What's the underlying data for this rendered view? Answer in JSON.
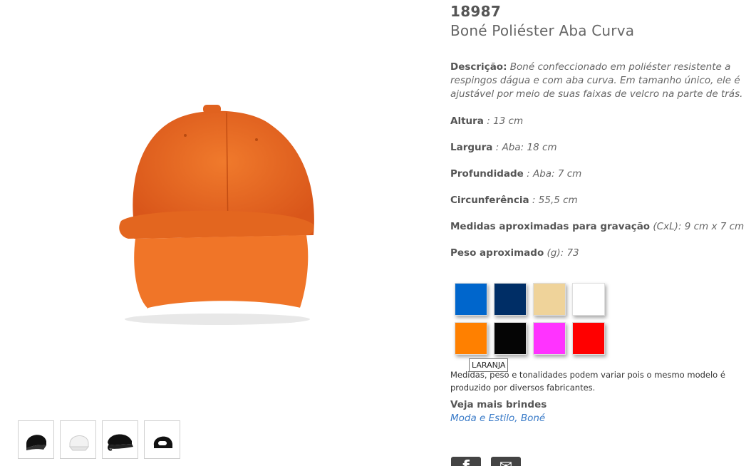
{
  "product": {
    "code": "18987",
    "title": "Boné Poliéster Aba Curva",
    "description_label": "Descrição:",
    "description_text": "Boné confeccionado em poliéster resistente a respingos dágua e com aba curva. Em tamanho único, ele é ajustável por meio de suas faixas de velcro na parte de trás."
  },
  "specs": [
    {
      "label": "Altura",
      "unit": "",
      "sep": " : ",
      "value": "13 cm"
    },
    {
      "label": "Largura",
      "unit": "",
      "sep": " : ",
      "value": "Aba: 18 cm"
    },
    {
      "label": "Profundidade",
      "unit": "",
      "sep": " : ",
      "value": "Aba: 7 cm"
    },
    {
      "label": "Circunferência",
      "unit": "",
      "sep": " : ",
      "value": "55,5 cm"
    },
    {
      "label": "Medidas aproximadas para gravação",
      "unit": " (CxL):",
      "sep": " ",
      "value": "9 cm x 7 cm"
    },
    {
      "label": "Peso aproximado",
      "unit": " (g):",
      "sep": " ",
      "value": "73"
    }
  ],
  "colors": [
    {
      "name": "azul",
      "hex": "#0066cc"
    },
    {
      "name": "azul marinho",
      "hex": "#002e66"
    },
    {
      "name": "bege",
      "hex": "#efd39a"
    },
    {
      "name": "branco",
      "hex": "#ffffff"
    },
    {
      "name": "laranja",
      "hex": "#ff8000"
    },
    {
      "name": "preto",
      "hex": "#050505"
    },
    {
      "name": "rosa",
      "hex": "#ff33ff"
    },
    {
      "name": "vermelho",
      "hex": "#ff0000"
    }
  ],
  "tooltip": "LARANJA",
  "note": "Medidas, peso e tonalidades podem variar pois o mesmo modelo é produzido por diversos fabricantes.",
  "more": {
    "title": "Veja mais brindes",
    "link1": "Moda e Estilo",
    "comma": ", ",
    "link2": "Boné"
  },
  "share": {
    "facebook": "f",
    "email": "✉"
  },
  "thumbnails": [
    "black-cap",
    "white-cap",
    "black-cap-side",
    "black-cap-back"
  ],
  "accent_color": "#3a7bc8"
}
